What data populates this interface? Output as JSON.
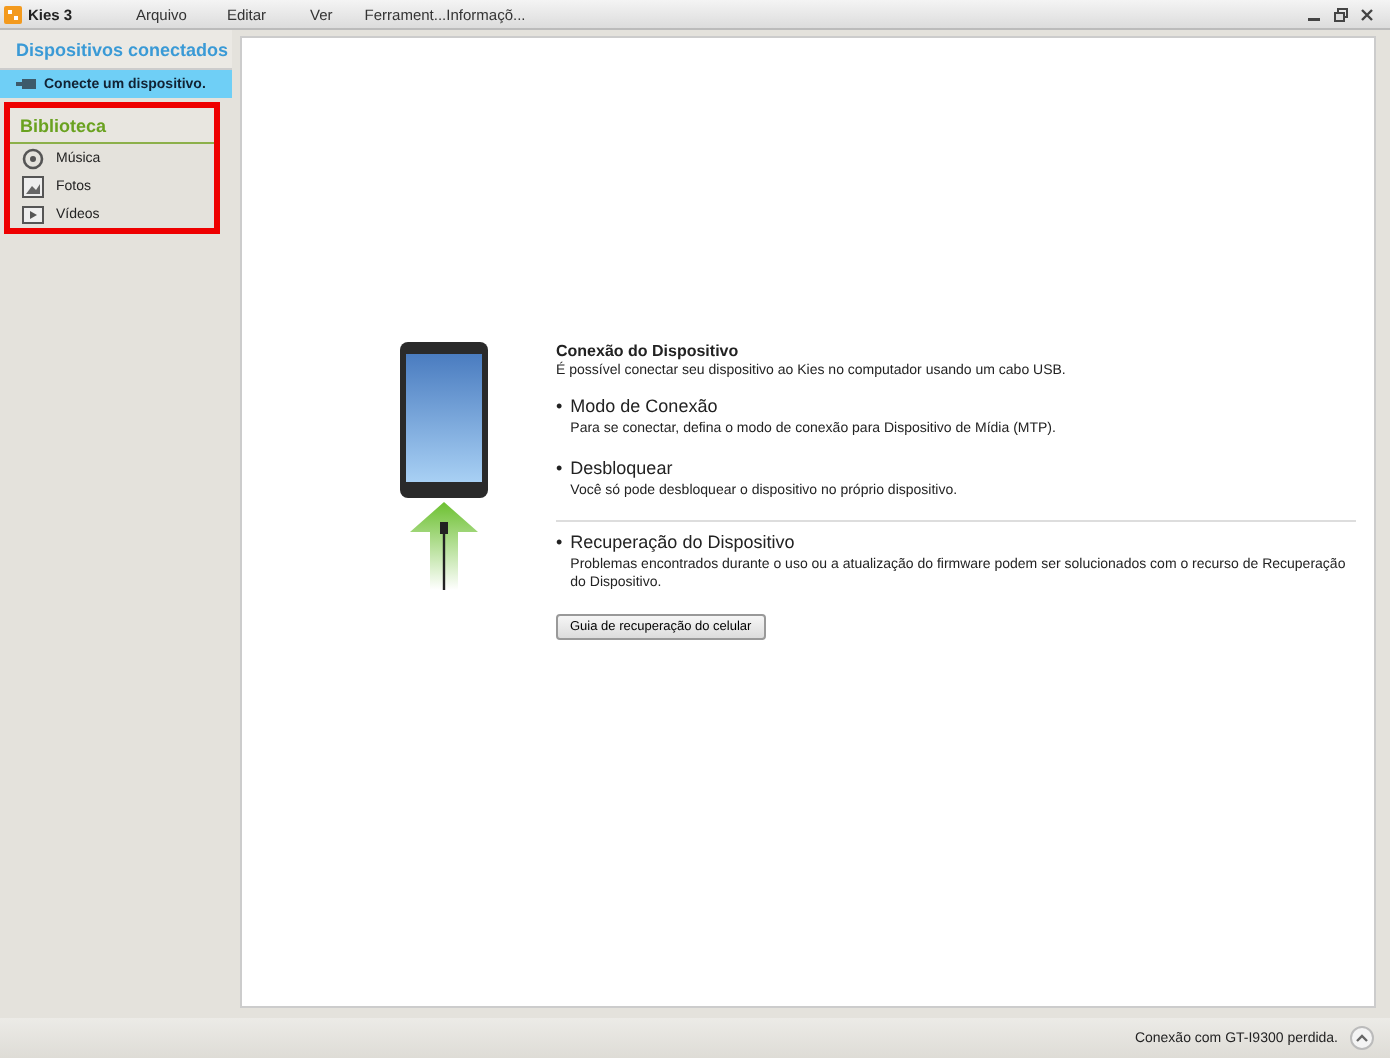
{
  "window": {
    "title": "Kies 3",
    "menu": [
      "Arquivo",
      "Editar",
      "Ver",
      "Ferrament...",
      "Informaçõ..."
    ]
  },
  "sidebar": {
    "devices_header": "Dispositivos conectados",
    "devices": [
      {
        "label": "Conecte um dispositivo.",
        "selected": true
      }
    ],
    "library_header": "Biblioteca",
    "library_highlighted": true,
    "library": [
      {
        "label": "Música",
        "kind": "music",
        "selected": false
      },
      {
        "label": "Fotos",
        "kind": "photos",
        "selected": false
      },
      {
        "label": "Vídeos",
        "kind": "videos",
        "selected": false
      }
    ]
  },
  "content": {
    "title": "Conexão do Dispositivo",
    "intro": "É possível conectar seu dispositivo ao Kies no computador usando um cabo USB.",
    "sections": [
      {
        "bullet": "•",
        "heading": "Modo de Conexão",
        "text": "Para se conectar, defina o modo de conexão para Dispositivo de Mídia (MTP).",
        "divider_before": false
      },
      {
        "bullet": "•",
        "heading": "Desbloquear",
        "text": "Você só pode desbloquear o dispositivo no próprio dispositivo.",
        "divider_before": false
      },
      {
        "bullet": "•",
        "heading": "Recuperação do Dispositivo",
        "text": "Problemas encontrados durante o uso ou a atualização do firmware podem ser solucionados com o recurso de Recuperação do Dispositivo.",
        "divider_before": true
      }
    ],
    "button": "Guia de recuperação do celular"
  },
  "status_bar": {
    "text": "Conexão com GT-I9300 perdida."
  }
}
